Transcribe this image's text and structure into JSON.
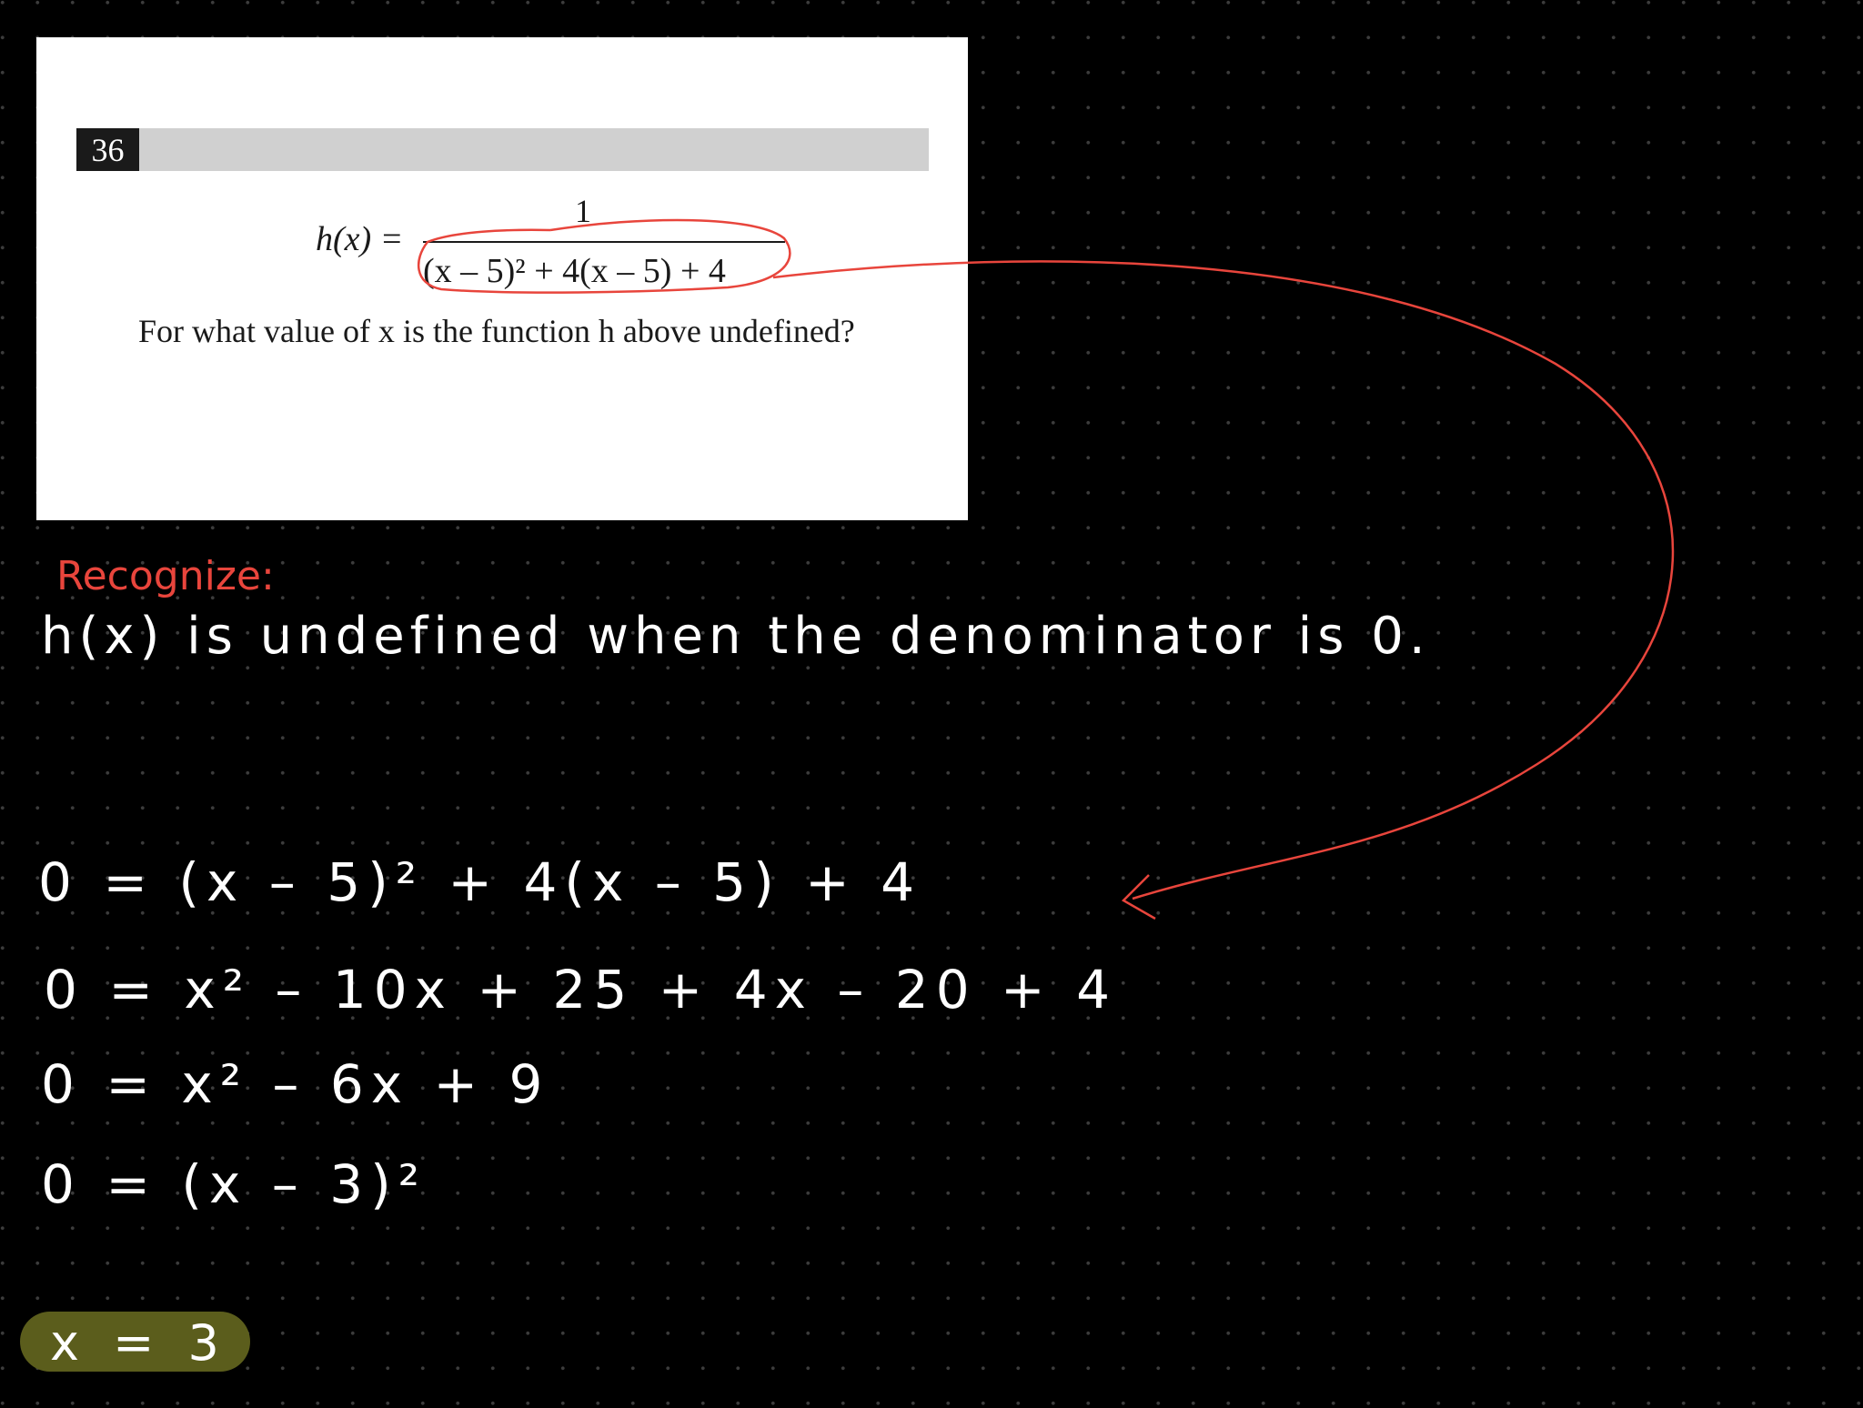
{
  "question": {
    "number": "36",
    "function_lhs": "h(x) =",
    "function_numerator": "1",
    "function_denominator": "(x – 5)² + 4(x – 5) + 4",
    "prompt": "For what value of x is the function h above undefined?"
  },
  "annotations": {
    "recognize_label": "Recognize:",
    "explanation": "h(x) is undefined when the denominator is 0.",
    "steps": [
      "0 = (x – 5)² + 4(x – 5) + 4",
      "0 = x² – 10x + 25 + 4x – 20 + 4",
      "0 = x² – 6x + 9",
      "0 = (x – 3)²"
    ],
    "answer": "x = 3"
  },
  "colors": {
    "background": "#000000",
    "card": "#ffffff",
    "ink": "#ffffff",
    "annotation_red": "#e8453c",
    "answer_highlight": "#5b5d1c"
  }
}
